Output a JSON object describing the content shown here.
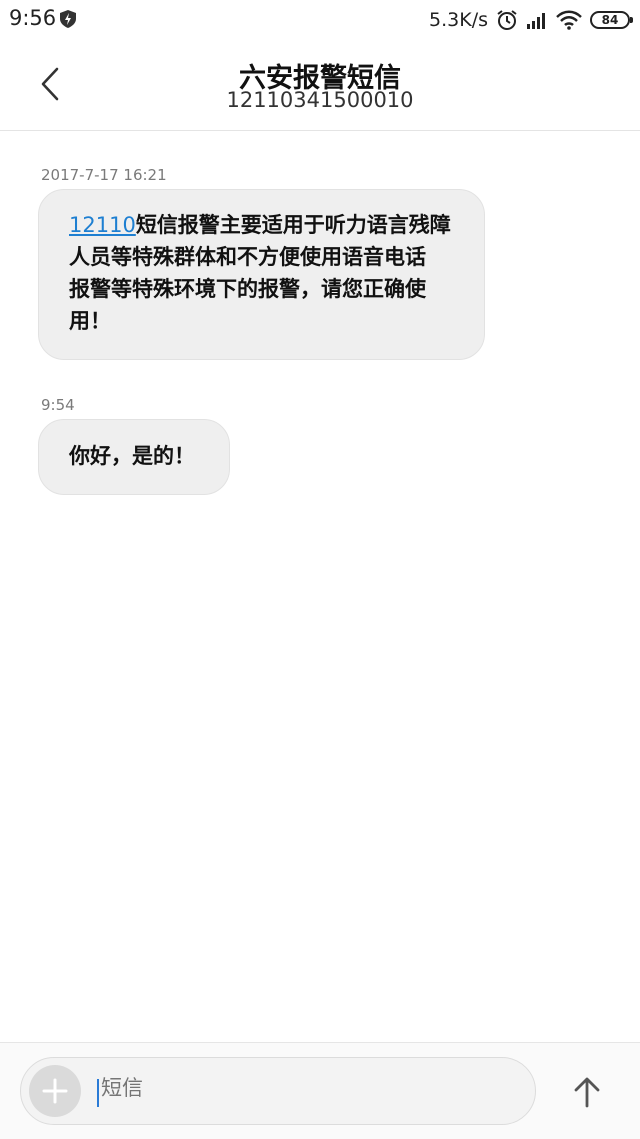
{
  "status_bar": {
    "time": "9:56",
    "net_speed": "5.3K/s",
    "battery": "84",
    "icons": [
      "shield-icon",
      "alarm-clock-icon",
      "signal-icon",
      "wifi-icon",
      "battery-icon"
    ]
  },
  "header": {
    "title": "六安报警短信",
    "number": "12110341500010",
    "back_icon": "chevron-left-icon"
  },
  "messages": [
    {
      "timestamp": "2017-7-17 16:21",
      "link_text": "12110",
      "line1": "短信报警主要适用于听力语言残障",
      "line2": "人员等特殊群体和不方便使用语音电话",
      "line3": "报警等特殊环境下的报警，请您正确使",
      "line4": "用！"
    },
    {
      "timestamp": "9:54",
      "text": "你好，是的！"
    }
  ],
  "composer": {
    "placeholder": "短信",
    "add_icon": "plus-icon",
    "send_icon": "arrow-up-icon"
  },
  "colors": {
    "link": "#1e7fd1",
    "bubble": "#efefef",
    "cursor": "#2a7bd6"
  }
}
